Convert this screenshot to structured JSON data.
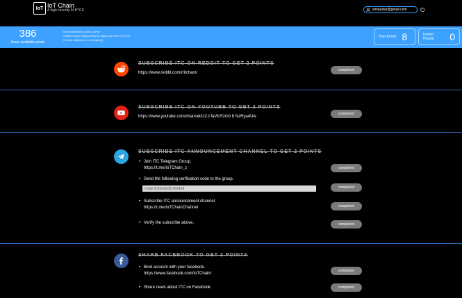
{
  "header": {
    "logo_text": "IoT",
    "brand_title": "IoT Chain",
    "brand_subtitle": "A high security Itt BTCS",
    "email": "wmeaster@gmail.com"
  },
  "points_bar": {
    "points": "386",
    "points_label": "itcsys available points",
    "notes": [
      "Total reward 500 points prizeg",
      "Publish reward 500points(sh) Happy one from 0 ITC(s)",
      "The last addressed on Tempthe()"
    ],
    "your_points_label": "Your Points",
    "your_points_value": "8",
    "invited_label": "Invited People",
    "invited_value": "0"
  },
  "reddit": {
    "title": "SUBSCRIBE ITC ON REDDIT TO GET 2 POINTS",
    "url": "https://www.reddit.com/r/itcham/",
    "button": "completed"
  },
  "youtube": {
    "title": "SUBSCRIBE ITC ON YOUTUBE TO GET 2 POINTS",
    "url": "https://www.youtube.com/channel/UCJ faVb7fzm0 8 NzRya4Uw",
    "button": "completed"
  },
  "telegram": {
    "title": "SUBSCRIBE ITC ANNOUNCEMENT CHANNEL TO GET 2 POINTS",
    "step1_line1": "Join ITC Telegram Group.",
    "step1_line2": "https://t.me/IoTChain_z",
    "step1_button": "completed",
    "step2_line1": "Send the following verification code to the group.",
    "step2_code": "/code 0c63c0a18c45e42d",
    "step2_button": "completed",
    "step3_line1": "Subscribe ITC announcement channel.",
    "step3_line2": "https://t.me/IoTChainChannel",
    "step3_button": "completed",
    "step4_line1": "Verify the subscribe above.",
    "step4_button": "completed"
  },
  "facebook": {
    "title": "SHARE FACEBOOK TO GET 2 POINTS",
    "step1_line1": "Bind account with your facebook.",
    "step1_line2": "https://www.facebook.com/IoTChain/",
    "step1_button": "completed",
    "step2_line1": "Share news about ITC on Facebook.",
    "step2_button": "completed"
  },
  "colors": {
    "accent": "#3da1ff",
    "reddit": "#ff4500",
    "youtube": "#e62117",
    "telegram": "#2ca5e0",
    "facebook": "#3b5998",
    "button": "#7a7a7a"
  }
}
